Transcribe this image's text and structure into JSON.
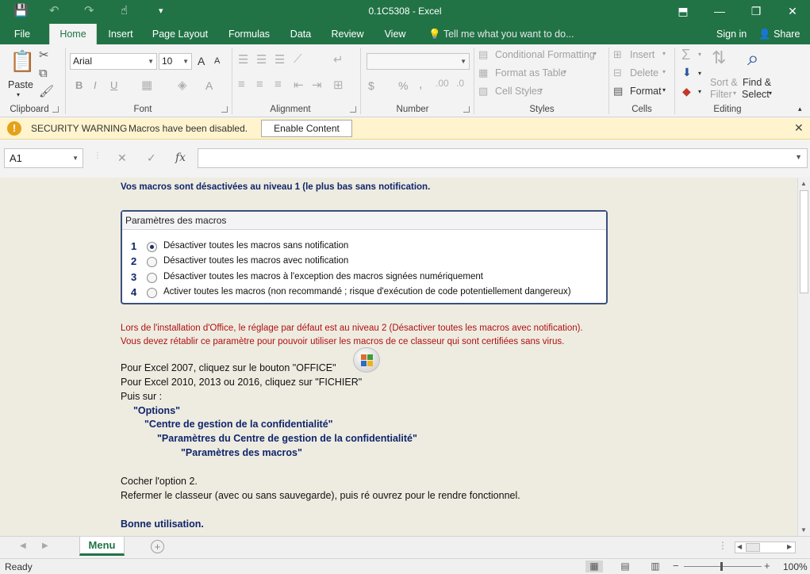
{
  "window": {
    "title": "0.1C5308 - Excel",
    "minimize": "—",
    "restore": "❐",
    "close": "✕",
    "ribbon_display": "⬒"
  },
  "quick_access": {
    "save": "💾",
    "undo": "↶",
    "redo": "↷",
    "touch": "☝",
    "customize": "▾"
  },
  "tabs": [
    "File",
    "Home",
    "Insert",
    "Page Layout",
    "Formulas",
    "Data",
    "Review",
    "View"
  ],
  "active_tab": "Home",
  "tell_me": "Tell me what you want to do...",
  "account": {
    "signin": "Sign in",
    "share": "Share"
  },
  "ribbon": {
    "clipboard": {
      "paste": "Paste",
      "label": "Clipboard"
    },
    "font": {
      "name": "Arial",
      "size": "10",
      "label": "Font",
      "grow": "A",
      "shrink": "A",
      "bold": "B",
      "italic": "I",
      "underline": "U",
      "color": "A"
    },
    "alignment": {
      "label": "Alignment"
    },
    "number": {
      "label": "Number",
      "format": "",
      "currency": "$",
      "percent": "%",
      "comma": ","
    },
    "styles": {
      "label": "Styles",
      "conditional": "Conditional Formatting",
      "format_table": "Format as Table",
      "cell_styles": "Cell Styles"
    },
    "cells": {
      "label": "Cells",
      "insert": "Insert",
      "delete": "Delete",
      "format": "Format"
    },
    "editing": {
      "label": "Editing",
      "sort": "Sort &",
      "filter": "Filter",
      "find": "Find &",
      "select": "Select"
    }
  },
  "security": {
    "title": "SECURITY WARNING",
    "message": "Macros have been disabled.",
    "button": "Enable Content"
  },
  "formula_bar": {
    "name_box": "A1",
    "fx": "fx",
    "cancel": "✕",
    "enter": "✓",
    "value": ""
  },
  "sheet": {
    "header_line": "Vos macros sont désactivées au niveau 1 (le plus bas sans notification.",
    "panel_title": "Paramètres des macros",
    "options": [
      {
        "num": "1",
        "label": "Désactiver toutes les macros sans notification",
        "selected": true
      },
      {
        "num": "2",
        "label": "Désactiver toutes les macros avec notification",
        "selected": false
      },
      {
        "num": "3",
        "label": "Désactiver toutes les macros à l'exception des macros signées numériquement",
        "selected": false
      },
      {
        "num": "4",
        "label": "Activer toutes les macros (non recommandé ; risque d'exécution de code potentiellement dangereux)",
        "selected": false
      }
    ],
    "red_line_1": "Lors de l'installation d'Office, le réglage par défaut est au niveau 2 (Désactiver toutes les macros avec notification).",
    "red_line_2": "Vous devez rétablir ce paramètre pour pouvoir utiliser les macros de ce classeur qui sont certifiées sans virus.",
    "excel2007": "Pour Excel 2007, cliquez sur le bouton \"OFFICE\"",
    "excel2010": "Pour Excel 2010, 2013 ou 2016, cliquez sur \"FICHIER\"",
    "puis": "Puis sur :",
    "path_1": "\"Options\"",
    "path_2": "\"Centre de gestion de la confidentialité\"",
    "path_3": "\"Paramètres du Centre de gestion de la confidentialité\"",
    "path_4": "\"Paramètres des macros\"",
    "cocher": "Cocher l'option 2.",
    "refermer": "Refermer le classeur (avec ou sans sauvegarde), puis ré ouvrez pour le rendre fonctionnel.",
    "bonne": "Bonne utilisation."
  },
  "sheet_tabs": {
    "active": "Menu",
    "add": "+"
  },
  "status": {
    "ready": "Ready",
    "zoom": "100%",
    "zoom_level": 100,
    "minus": "−",
    "plus": "+"
  }
}
